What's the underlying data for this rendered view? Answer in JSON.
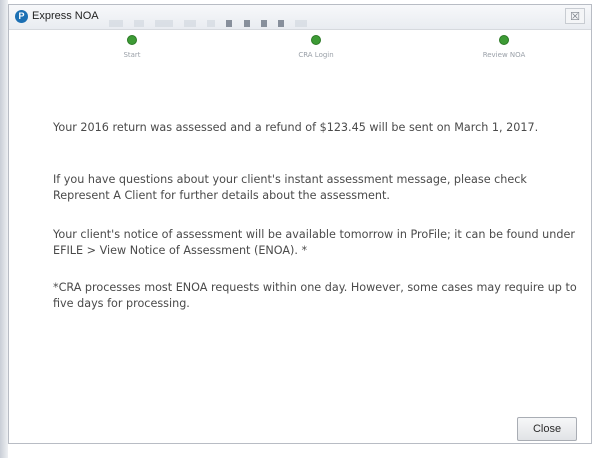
{
  "window": {
    "title": "Express NOA",
    "close_glyph": "☒"
  },
  "steps": [
    {
      "label": "Start"
    },
    {
      "label": "CRA Login"
    },
    {
      "label": "Review NOA"
    }
  ],
  "colors": {
    "step_complete": "#3d9b35",
    "app_icon": "#1b6fb3",
    "body_text": "#4a4a4a"
  },
  "messages": {
    "refund": "Your 2016 return was assessed and a refund of $123.45 will be sent on March 1, 2017.",
    "questions": "If you have questions about your client's instant assessment message, please check Represent A Client for further details about the assessment.",
    "availability": "Your client's notice of assessment will be available tomorrow in ProFile; it can be found under EFILE > View Notice of Assessment (ENOA). *",
    "footnote": "*CRA processes most ENOA requests within one day. However, some cases may require up to five days for processing."
  },
  "actions": {
    "close_label": "Close"
  },
  "icons": {
    "app": "express-noa-app-icon",
    "step": "checkmark-dot-icon"
  }
}
